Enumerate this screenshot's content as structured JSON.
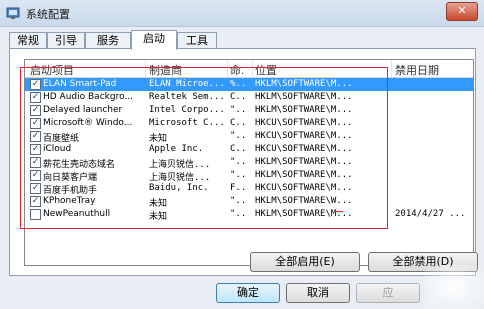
{
  "window": {
    "title": "系统配置",
    "close_label": "✕"
  },
  "tabs": [
    "常规",
    "引导",
    "服务",
    "启动",
    "工具"
  ],
  "active_tab": "启动",
  "list": {
    "headers": [
      "启动项目",
      "制造商",
      "命.",
      "位置",
      "禁用日期"
    ],
    "rows": [
      {
        "checked": true,
        "name": "ELAN Smart-Pad",
        "maker": "ELAN Microe...",
        "cmd": "%..",
        "loc": "HKLM\\SOFTWARE\\M...",
        "date": ""
      },
      {
        "checked": true,
        "name": "HD Audio Backgro...",
        "maker": "Realtek Sem...",
        "cmd": "C...",
        "loc": "HKLM\\SOFTWARE\\M...",
        "date": ""
      },
      {
        "checked": true,
        "name": "Delayed launcher",
        "maker": "Intel Corpo...",
        "cmd": "\"...",
        "loc": "HKLM\\SOFTWARE\\M...",
        "date": ""
      },
      {
        "checked": true,
        "name": "Microsoft® Windo...",
        "maker": "Microsoft C...",
        "cmd": "C...",
        "loc": "HKCU\\SOFTWARE\\M...",
        "date": ""
      },
      {
        "checked": true,
        "name": "百度壁纸",
        "maker": "未知",
        "cmd": "\"...",
        "loc": "HKCU\\SOFTWARE\\M...",
        "date": ""
      },
      {
        "checked": true,
        "name": "iCloud",
        "maker": "Apple Inc.",
        "cmd": "C...",
        "loc": "HKCU\\SOFTWARE\\M...",
        "date": ""
      },
      {
        "checked": true,
        "name": "薪花生壳动态域名",
        "maker": "上海贝锐信...",
        "cmd": "\"...",
        "loc": "HKLM\\SOFTWARE\\M...",
        "date": ""
      },
      {
        "checked": true,
        "name": "向日葵客户端",
        "maker": "上海贝锐信...",
        "cmd": "\"...",
        "loc": "HKLM\\SOFTWARE\\M...",
        "date": ""
      },
      {
        "checked": true,
        "name": "百度手机助手",
        "maker": "Baidu, Inc.",
        "cmd": "F...",
        "loc": "HKCU\\SOFTWARE\\M...",
        "date": ""
      },
      {
        "checked": true,
        "name": "KPhoneTray",
        "maker": "未知",
        "cmd": "\"...",
        "loc": "HKLM\\SOFTWARE\\W...",
        "date": ""
      },
      {
        "checked": false,
        "name": "NewPeanuthull",
        "maker": "未知",
        "cmd": "\"...",
        "loc": "HKLM\\SOFTWARE\\M...",
        "date": "2014/4/27 ..."
      }
    ]
  },
  "buttons": {
    "enable_all": "全部启用(E)",
    "disable_all": "全部禁用(D)",
    "ok": "确定",
    "cancel": "取消",
    "apply": "应"
  },
  "colors": {
    "selection": "#3399ff",
    "highlight_box": "#e8202a"
  }
}
